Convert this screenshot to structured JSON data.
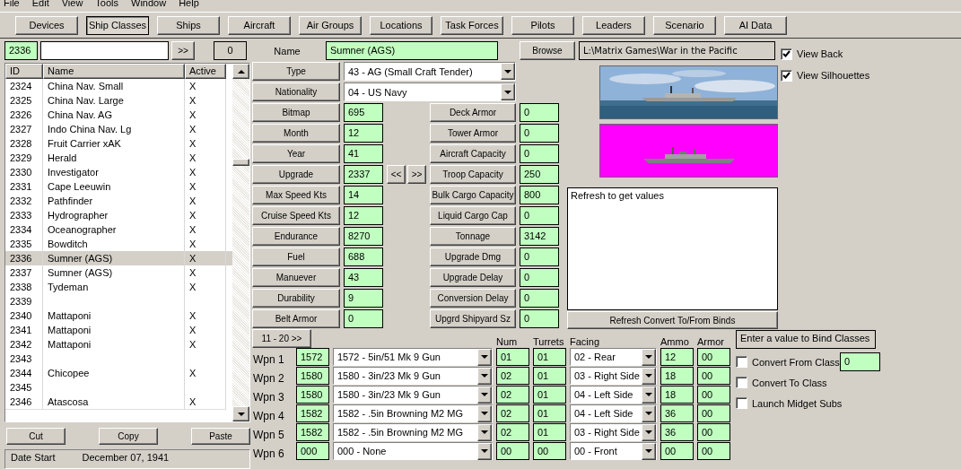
{
  "menu": [
    "File",
    "Edit",
    "View",
    "Tools",
    "Window",
    "Help"
  ],
  "toolbar": [
    {
      "label": "Devices",
      "selected": false
    },
    {
      "label": "Ship Classes",
      "selected": true
    },
    {
      "label": "Ships",
      "selected": false
    },
    {
      "label": "Aircraft",
      "selected": false
    },
    {
      "label": "Air Groups",
      "selected": false
    },
    {
      "label": "Locations",
      "selected": false
    },
    {
      "label": "Task Forces",
      "selected": false
    },
    {
      "label": "Pilots",
      "selected": false
    },
    {
      "label": "Leaders",
      "selected": false
    },
    {
      "label": "Scenario",
      "selected": false
    },
    {
      "label": "AI Data",
      "selected": false
    }
  ],
  "class_list": {
    "current_id": "2336",
    "go_button": ">>",
    "count": "0",
    "columns": [
      "ID",
      "Name",
      "Active"
    ],
    "rows": [
      {
        "id": "2324",
        "name": "China Nav. Small",
        "active": "X",
        "selected": false
      },
      {
        "id": "2325",
        "name": "China Nav. Large",
        "active": "X",
        "selected": false
      },
      {
        "id": "2326",
        "name": "China Nav. AG",
        "active": "X",
        "selected": false
      },
      {
        "id": "2327",
        "name": "Indo China Nav. Lg",
        "active": "X",
        "selected": false
      },
      {
        "id": "2328",
        "name": "Fruit Carrier xAK",
        "active": "X",
        "selected": false
      },
      {
        "id": "2329",
        "name": "Herald",
        "active": "X",
        "selected": false
      },
      {
        "id": "2330",
        "name": "Investigator",
        "active": "X",
        "selected": false
      },
      {
        "id": "2331",
        "name": "Cape Leeuwin",
        "active": "X",
        "selected": false
      },
      {
        "id": "2332",
        "name": "Pathfinder",
        "active": "X",
        "selected": false
      },
      {
        "id": "2333",
        "name": "Hydrographer",
        "active": "X",
        "selected": false
      },
      {
        "id": "2334",
        "name": "Oceanographer",
        "active": "X",
        "selected": false
      },
      {
        "id": "2335",
        "name": "Bowditch",
        "active": "X",
        "selected": false
      },
      {
        "id": "2336",
        "name": "Sumner (AGS)",
        "active": "X",
        "selected": true
      },
      {
        "id": "2337",
        "name": "Sumner (AGS)",
        "active": "X",
        "selected": false
      },
      {
        "id": "2338",
        "name": "Tydeman",
        "active": "X",
        "selected": false
      },
      {
        "id": "2339",
        "selected": false
      },
      {
        "id": "2340",
        "name": "Mattaponi",
        "active": "X",
        "selected": false
      },
      {
        "id": "2341",
        "name": "Mattaponi",
        "active": "X",
        "selected": false
      },
      {
        "id": "2342",
        "name": "Mattaponi",
        "active": "X",
        "selected": false
      },
      {
        "id": "2343",
        "selected": false
      },
      {
        "id": "2344",
        "name": "Chicopee",
        "active": "X",
        "selected": false
      },
      {
        "id": "2345",
        "selected": false
      },
      {
        "id": "2346",
        "name": "Atascosa",
        "active": "X",
        "selected": false
      }
    ],
    "buttons": [
      "Cut",
      "Copy",
      "Paste"
    ],
    "date_label": "Date Start",
    "date_value": "December 07, 1941"
  },
  "detail": {
    "name_label": "Name",
    "name": "Sumner (AGS)",
    "browse": "Browse",
    "path": "L:\\Matrix Games\\War in the Pacific",
    "type": {
      "label": "Type",
      "value": "43 - AG (Small Craft Tender)"
    },
    "nationality": {
      "label": "Nationality",
      "value": "04 - US Navy"
    },
    "fields_left": [
      {
        "label": "Bitmap",
        "value": "695"
      },
      {
        "label": "Month",
        "value": "12"
      },
      {
        "label": "Year",
        "value": "41"
      },
      {
        "label": "Upgrade",
        "value": "2337"
      },
      {
        "label": "Max Speed Kts",
        "value": "14"
      },
      {
        "label": "Cruise Speed Kts",
        "value": "12"
      },
      {
        "label": "Endurance",
        "value": "8270"
      },
      {
        "label": "Fuel",
        "value": "688"
      },
      {
        "label": "Manuever",
        "value": "43"
      },
      {
        "label": "Durability",
        "value": "9"
      },
      {
        "label": "Belt Armor",
        "value": "0"
      }
    ],
    "upgrade_nav": [
      "<<",
      ">>"
    ],
    "fields_right": [
      {
        "label": "Deck Armor",
        "value": "0"
      },
      {
        "label": "Tower Armor",
        "value": "0"
      },
      {
        "label": "Aircraft Capacity",
        "value": "0"
      },
      {
        "label": "Troop Capacity",
        "value": "250"
      },
      {
        "label": "Bulk Cargo Capacity",
        "value": "800"
      },
      {
        "label": "Liquid Cargo Cap",
        "value": "0"
      },
      {
        "label": "Tonnage",
        "value": "3142"
      },
      {
        "label": "Upgrade Dmg",
        "value": "0"
      },
      {
        "label": "Upgrade Delay",
        "value": "0"
      },
      {
        "label": "Conversion Delay",
        "value": "0"
      },
      {
        "label": "Upgrd Shipyard Sz",
        "value": "0"
      }
    ],
    "notes": "Refresh to get values",
    "refresh_button": "Refresh Convert To/From Binds",
    "view_options": [
      {
        "label": "View Back",
        "checked": true
      },
      {
        "label": "View Silhouettes",
        "checked": true
      }
    ]
  },
  "weapons": {
    "page_button": "11 - 20 >>",
    "columns": [
      "Num",
      "Turrets",
      "Facing",
      "Ammo",
      "Armor"
    ],
    "rows": [
      {
        "label": "Wpn 1",
        "id": "1572",
        "device": "1572 - 5in/51 Mk 9 Gun",
        "num": "01",
        "turrets": "01",
        "facing": "02 - Rear",
        "ammo": "12",
        "armor": "00"
      },
      {
        "label": "Wpn 2",
        "id": "1580",
        "device": "1580 - 3in/23 Mk 9 Gun",
        "num": "02",
        "turrets": "01",
        "facing": "03 - Right Side",
        "ammo": "18",
        "armor": "00"
      },
      {
        "label": "Wpn 3",
        "id": "1580",
        "device": "1580 - 3in/23 Mk 9 Gun",
        "num": "02",
        "turrets": "01",
        "facing": "04 - Left Side",
        "ammo": "18",
        "armor": "00"
      },
      {
        "label": "Wpn 4",
        "id": "1582",
        "device": "1582 - .5in Browning M2 MG",
        "num": "02",
        "turrets": "01",
        "facing": "04 - Left Side",
        "ammo": "36",
        "armor": "00"
      },
      {
        "label": "Wpn 5",
        "id": "1582",
        "device": "1582 - .5in Browning M2 MG",
        "num": "02",
        "turrets": "01",
        "facing": "03 - Right Side",
        "ammo": "36",
        "armor": "00"
      },
      {
        "label": "Wpn 6",
        "id": "000",
        "device": "000 - None",
        "num": "00",
        "turrets": "00",
        "facing": "00 - Front",
        "ammo": "00",
        "armor": "00"
      }
    ]
  },
  "bind": {
    "title": "Enter a value to Bind Classes",
    "value": "0",
    "options": [
      {
        "label": "Convert From Class",
        "checked": false
      },
      {
        "label": "Convert To Class",
        "checked": false
      },
      {
        "label": "Launch Midget Subs",
        "checked": false
      }
    ]
  }
}
